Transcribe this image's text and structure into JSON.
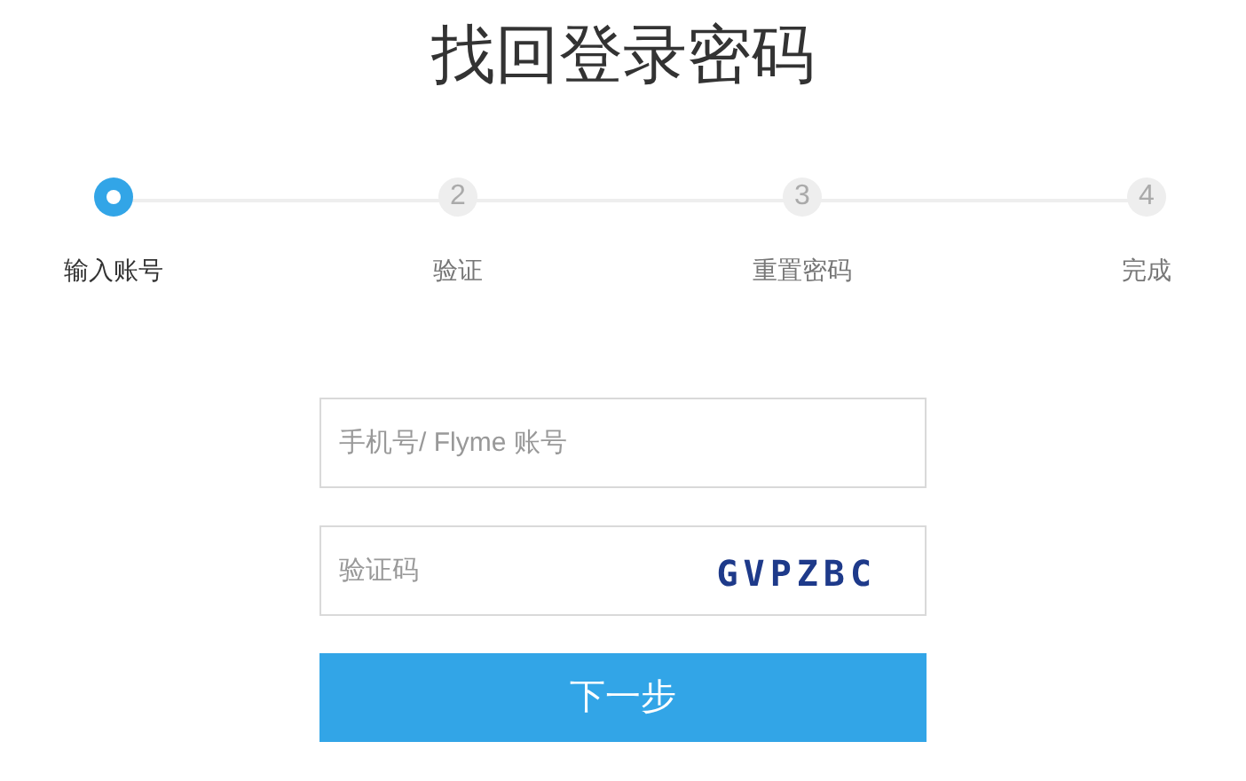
{
  "title": "找回登录密码",
  "steps": [
    {
      "label": "输入账号",
      "selected": true
    },
    {
      "number": "2",
      "label": "验证",
      "selected": false
    },
    {
      "number": "3",
      "label": "重置密码",
      "selected": false
    },
    {
      "number": "4",
      "label": "完成",
      "selected": false
    }
  ],
  "account_field": {
    "placeholder": "手机号/ Flyme 账号"
  },
  "captcha_field": {
    "placeholder": "验证码",
    "captcha": "GVPZBC"
  },
  "next_button": "下一步"
}
